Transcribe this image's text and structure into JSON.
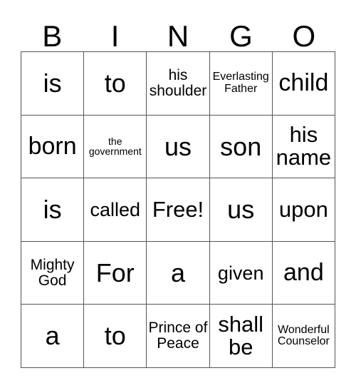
{
  "card": {
    "type": "bingo-card",
    "columns": 5,
    "rows": 5,
    "border_color": "#555555",
    "background_color": "#ffffff",
    "text_color": "#000000"
  },
  "header": {
    "letters": [
      "B",
      "I",
      "N",
      "G",
      "O"
    ]
  },
  "grid": {
    "rows": [
      {
        "cells": [
          {
            "text": "is",
            "size": "fs-xxl"
          },
          {
            "text": "to",
            "size": "fs-xxl"
          },
          {
            "text": "his shoulder",
            "size": "fs-sm"
          },
          {
            "text": "Everlasting Father",
            "size": "fs-xs"
          },
          {
            "text": "child",
            "size": "fs-xl"
          }
        ]
      },
      {
        "cells": [
          {
            "text": "born",
            "size": "fs-xl"
          },
          {
            "text": "the government",
            "size": "fs-xxs"
          },
          {
            "text": "us",
            "size": "fs-xxl"
          },
          {
            "text": "son",
            "size": "fs-xxl"
          },
          {
            "text": "his name",
            "size": "fs-lg"
          }
        ]
      },
      {
        "cells": [
          {
            "text": "is",
            "size": "fs-xxl"
          },
          {
            "text": "called",
            "size": "fs-md"
          },
          {
            "text": "Free!",
            "size": "fs-lg"
          },
          {
            "text": "us",
            "size": "fs-xxl"
          },
          {
            "text": "upon",
            "size": "fs-lg"
          }
        ]
      },
      {
        "cells": [
          {
            "text": "Mighty God",
            "size": "fs-sm"
          },
          {
            "text": "For",
            "size": "fs-xxl"
          },
          {
            "text": "a",
            "size": "fs-xxl"
          },
          {
            "text": "given",
            "size": "fs-md"
          },
          {
            "text": "and",
            "size": "fs-xl"
          }
        ]
      },
      {
        "cells": [
          {
            "text": "a",
            "size": "fs-xxl"
          },
          {
            "text": "to",
            "size": "fs-xxl"
          },
          {
            "text": "Prince of Peace",
            "size": "fs-sm"
          },
          {
            "text": "shall be",
            "size": "fs-lg"
          },
          {
            "text": "Wonderful Counselor",
            "size": "fs-xs"
          }
        ]
      }
    ]
  }
}
